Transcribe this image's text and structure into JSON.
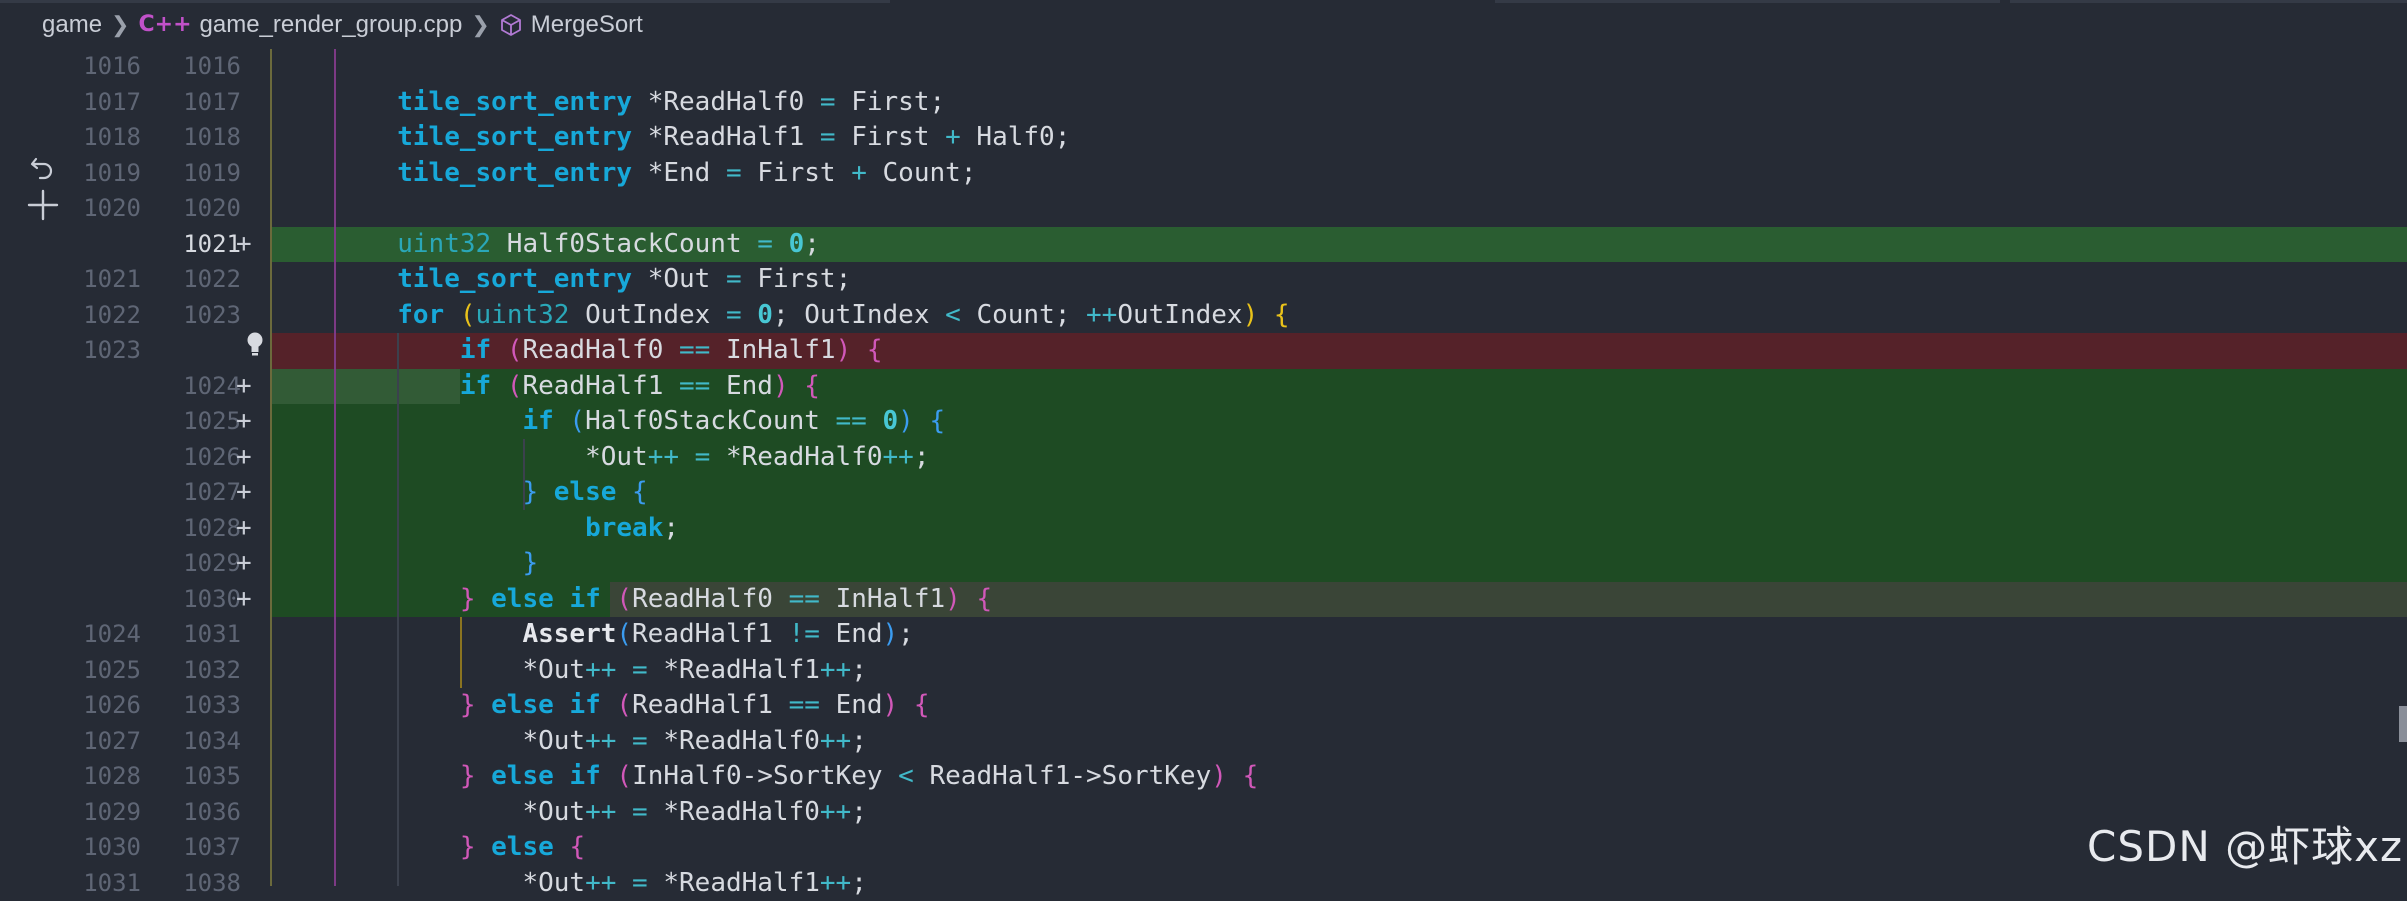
{
  "breadcrumb": {
    "folder": "game",
    "file": "game_render_group.cpp",
    "symbol": "MergeSort"
  },
  "icons": {
    "file_icon": "cpp-file-icon",
    "symbol_icon": "cube-method-icon",
    "undo_icon": "revert-change-icon",
    "add_icon": "plus-icon",
    "bulb_icon": "lightbulb-icon"
  },
  "colors": {
    "added_line": "#1e4b23",
    "removed_line": "#552229",
    "keyword": "#17a8d9",
    "bracket_level1": "#e9c21a",
    "bracket_level2": "#d158b9",
    "bracket_level3": "#3b9cf0"
  },
  "diff_lines": [
    {
      "old": "1016",
      "new": "1016",
      "type": "context",
      "code": ""
    },
    {
      "old": "1017",
      "new": "1017",
      "type": "context",
      "code": "        tile_sort_entry *ReadHalf0 = First;"
    },
    {
      "old": "1018",
      "new": "1018",
      "type": "context",
      "code": "        tile_sort_entry *ReadHalf1 = First + Half0;"
    },
    {
      "old": "1019",
      "new": "1019",
      "type": "context",
      "code": "        tile_sort_entry *End = First + Count;"
    },
    {
      "old": "1020",
      "new": "1020",
      "type": "context",
      "code": ""
    },
    {
      "old": "",
      "new": "1021",
      "type": "added",
      "code": "        uint32 Half0StackCount = 0;"
    },
    {
      "old": "1021",
      "new": "1022",
      "type": "context",
      "code": "        tile_sort_entry *Out = First;"
    },
    {
      "old": "1022",
      "new": "1023",
      "type": "context",
      "code": "        for (uint32 OutIndex = 0; OutIndex < Count; ++OutIndex) {"
    },
    {
      "old": "1023",
      "new": "",
      "type": "removed",
      "code": "            if (ReadHalf0 == InHalf1) {"
    },
    {
      "old": "",
      "new": "1024",
      "type": "added",
      "code": "            if (ReadHalf1 == End) {"
    },
    {
      "old": "",
      "new": "1025",
      "type": "added",
      "code": "                if (Half0StackCount == 0) {"
    },
    {
      "old": "",
      "new": "1026",
      "type": "added",
      "code": "                    *Out++ = *ReadHalf0++;"
    },
    {
      "old": "",
      "new": "1027",
      "type": "added",
      "code": "                } else {"
    },
    {
      "old": "",
      "new": "1028",
      "type": "added",
      "code": "                    break;"
    },
    {
      "old": "",
      "new": "1029",
      "type": "added",
      "code": "                }"
    },
    {
      "old": "",
      "new": "1030",
      "type": "added",
      "code": "            } else if (ReadHalf0 == InHalf1) {"
    },
    {
      "old": "1024",
      "new": "1031",
      "type": "context",
      "code": "                Assert(ReadHalf1 != End);"
    },
    {
      "old": "1025",
      "new": "1032",
      "type": "context",
      "code": "                *Out++ = *ReadHalf1++;"
    },
    {
      "old": "1026",
      "new": "1033",
      "type": "context",
      "code": "            } else if (ReadHalf1 == End) {"
    },
    {
      "old": "1027",
      "new": "1034",
      "type": "context",
      "code": "                *Out++ = *ReadHalf0++;"
    },
    {
      "old": "1028",
      "new": "1035",
      "type": "context",
      "code": "            } else if (InHalf0->SortKey < ReadHalf1->SortKey) {"
    },
    {
      "old": "1029",
      "new": "1036",
      "type": "context",
      "code": "                *Out++ = *ReadHalf0++;"
    },
    {
      "old": "1030",
      "new": "1037",
      "type": "context",
      "code": "            } else {"
    },
    {
      "old": "1031",
      "new": "1038",
      "type": "context",
      "code": "                *Out++ = *ReadHalf1++;"
    }
  ],
  "watermark": "CSDN @虾球xz"
}
